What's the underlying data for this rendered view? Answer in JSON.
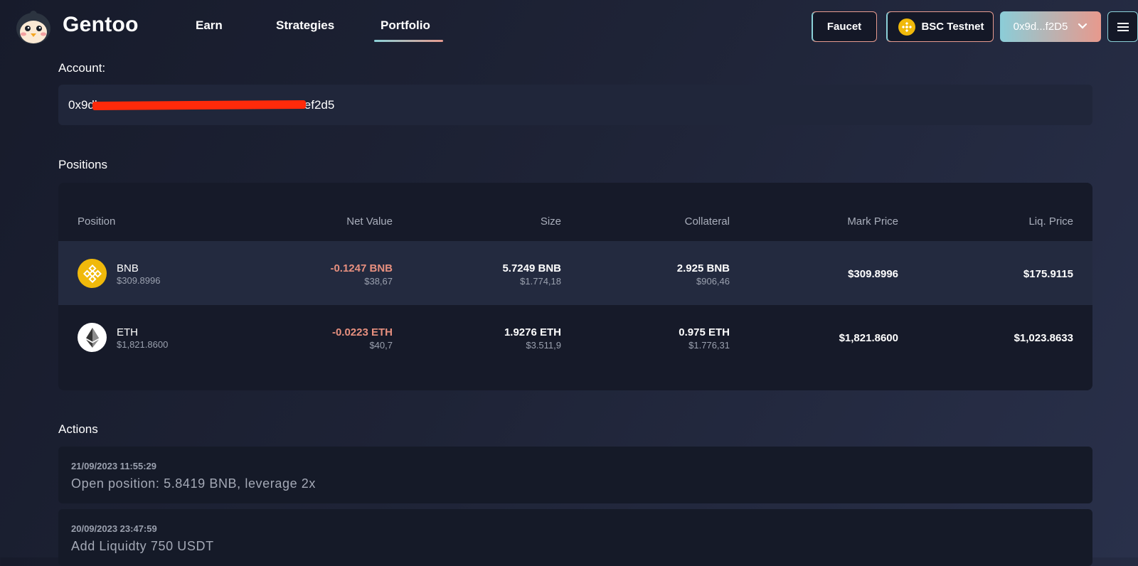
{
  "header": {
    "brand": "Gentoo",
    "nav": [
      {
        "label": "Earn"
      },
      {
        "label": "Strategies"
      },
      {
        "label": "Portfolio",
        "active": true
      }
    ],
    "faucet_label": "Faucet",
    "network_label": "BSC Testnet",
    "wallet_label": "0x9d...f2D5",
    "icons": {
      "network": "bnb-coin-icon",
      "wallet_chevron": "chevron-down-icon",
      "menu": "hamburger-menu-icon"
    }
  },
  "account": {
    "label": "Account:",
    "address_prefix": "0x9db",
    "address_suffix": "2ef2d5"
  },
  "positions": {
    "label": "Positions",
    "columns": [
      "Position",
      "Net Value",
      "Size",
      "Collateral",
      "Mark Price",
      "Liq. Price"
    ],
    "rows": [
      {
        "token": "BNB",
        "token_price": "$309.8996",
        "icon": "bnb-coin-icon",
        "net_value": "-0.1247 BNB",
        "net_value_usd": "$38,67",
        "size": "5.7249 BNB",
        "size_usd": "$1.774,18",
        "collateral": "2.925 BNB",
        "collateral_usd": "$906,46",
        "mark_price": "$309.8996",
        "liq_price": "$175.9115"
      },
      {
        "token": "ETH",
        "token_price": "$1,821.8600",
        "icon": "eth-coin-icon",
        "net_value": "-0.0223 ETH",
        "net_value_usd": "$40,7",
        "size": "1.9276 ETH",
        "size_usd": "$3.511,9",
        "collateral": "0.975 ETH",
        "collateral_usd": "$1.776,31",
        "mark_price": "$1,821.8600",
        "liq_price": "$1,023.8633"
      }
    ]
  },
  "actions": {
    "label": "Actions",
    "items": [
      {
        "date": "21/09/2023 11:55:29",
        "text": "Open position: 5.8419 BNB, leverage 2x"
      },
      {
        "date": "20/09/2023 23:47:59",
        "text": "Add Liquidty 750 USDT"
      }
    ]
  },
  "colors": {
    "accent_teal": "#8bd1d8",
    "accent_peach": "#e79b8f",
    "negative": "#e7907f",
    "bnb": "#f0b90b"
  }
}
